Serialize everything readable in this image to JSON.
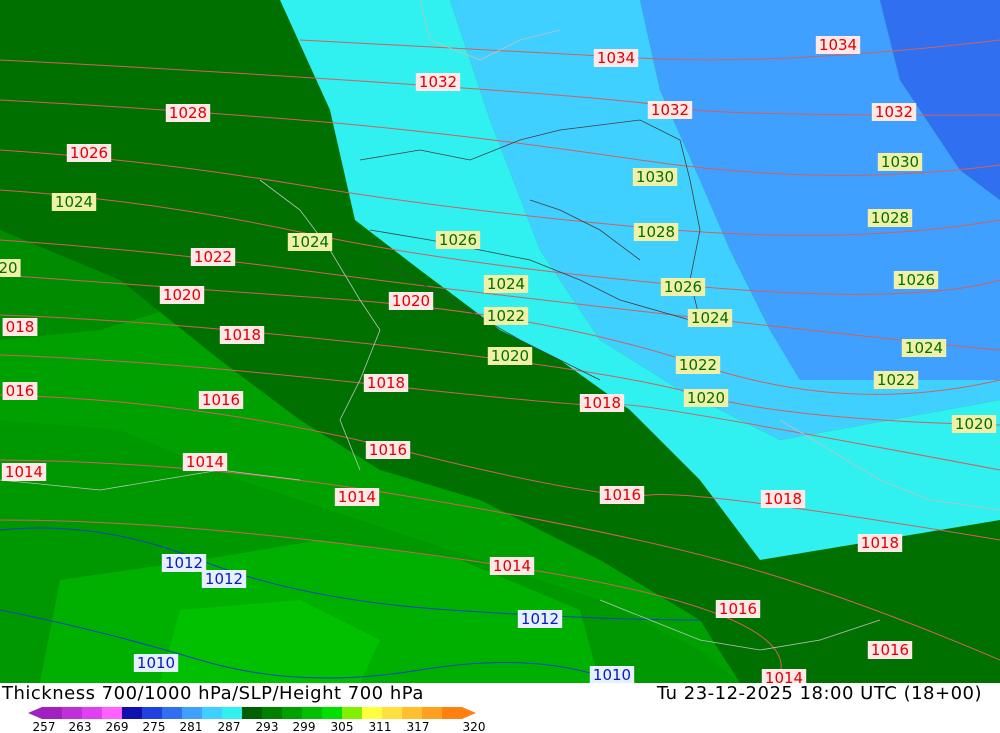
{
  "map": {
    "title": "Thickness 700/1000 hPa/SLP/Height 700 hPa",
    "datetime": "Tu 23-12-2025 18:00 UTC (18+00)",
    "isobar_labels": [
      {
        "text": "1034",
        "color": "red"
      },
      {
        "text": "1034",
        "color": "red"
      },
      {
        "text": "1032",
        "color": "red"
      },
      {
        "text": "1032",
        "color": "red"
      },
      {
        "text": "1032",
        "color": "red"
      },
      {
        "text": "1030",
        "color": "green"
      },
      {
        "text": "1030",
        "color": "green"
      },
      {
        "text": "1028",
        "color": "red"
      },
      {
        "text": "1028",
        "color": "green"
      },
      {
        "text": "1028",
        "color": "green"
      },
      {
        "text": "1026",
        "color": "red"
      },
      {
        "text": "1026",
        "color": "green"
      },
      {
        "text": "1026",
        "color": "green"
      },
      {
        "text": "1026",
        "color": "green"
      },
      {
        "text": "1024",
        "color": "green"
      },
      {
        "text": "1024",
        "color": "green"
      },
      {
        "text": "1024",
        "color": "green"
      },
      {
        "text": "1024",
        "color": "green"
      },
      {
        "text": "1024",
        "color": "green"
      },
      {
        "text": "1022",
        "color": "red"
      },
      {
        "text": "1022",
        "color": "green"
      },
      {
        "text": "1022",
        "color": "green"
      },
      {
        "text": "1022",
        "color": "green"
      },
      {
        "text": "20",
        "color": "green"
      },
      {
        "text": "1020",
        "color": "red"
      },
      {
        "text": "1020",
        "color": "red"
      },
      {
        "text": "1020",
        "color": "green"
      },
      {
        "text": "1020",
        "color": "green"
      },
      {
        "text": "1020",
        "color": "green"
      },
      {
        "text": "018",
        "color": "red"
      },
      {
        "text": "1018",
        "color": "red"
      },
      {
        "text": "1018",
        "color": "red"
      },
      {
        "text": "1018",
        "color": "red"
      },
      {
        "text": "1018",
        "color": "red"
      },
      {
        "text": "1018",
        "color": "red"
      },
      {
        "text": "016",
        "color": "red"
      },
      {
        "text": "1016",
        "color": "red"
      },
      {
        "text": "1016",
        "color": "red"
      },
      {
        "text": "1016",
        "color": "red"
      },
      {
        "text": "1016",
        "color": "red"
      },
      {
        "text": "1016",
        "color": "red"
      },
      {
        "text": "1014",
        "color": "red"
      },
      {
        "text": "1014",
        "color": "red"
      },
      {
        "text": "1014",
        "color": "red"
      },
      {
        "text": "1014",
        "color": "red"
      },
      {
        "text": "1014",
        "color": "red"
      },
      {
        "text": "1012",
        "color": "blue"
      },
      {
        "text": "1012",
        "color": "blue"
      },
      {
        "text": "1012",
        "color": "blue"
      },
      {
        "text": "1010",
        "color": "blue"
      },
      {
        "text": "1010",
        "color": "blue"
      }
    ]
  },
  "legend": {
    "ticks": [
      "257",
      "263",
      "269",
      "275",
      "281",
      "287",
      "293",
      "299",
      "305",
      "311",
      "317",
      "320"
    ],
    "colors": [
      "#a020c0",
      "#c030d8",
      "#e040f0",
      "#ff60ff",
      "#1010b0",
      "#2040e0",
      "#3070f0",
      "#40a0ff",
      "#40d0ff",
      "#30f0f0",
      "#006000",
      "#008000",
      "#00a000",
      "#00c000",
      "#00e000",
      "#80f000",
      "#ffff40",
      "#ffe040",
      "#ffc030",
      "#ffa020",
      "#ff8010"
    ]
  }
}
